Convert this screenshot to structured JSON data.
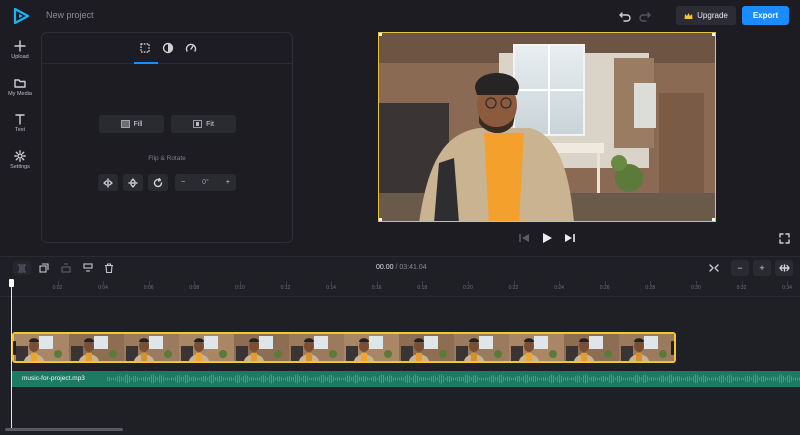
{
  "header": {
    "project_title": "New project",
    "upgrade_label": "Upgrade",
    "export_label": "Export",
    "brand_color": "#1a8cff"
  },
  "sidebar": {
    "items": [
      {
        "label": "Upload",
        "icon": "plus-icon"
      },
      {
        "label": "My Media",
        "icon": "folder-icon"
      },
      {
        "label": "Text",
        "icon": "text-icon"
      },
      {
        "label": "Settings",
        "icon": "gear-icon"
      }
    ]
  },
  "panel": {
    "tabs": [
      {
        "icon": "crop-icon",
        "active": true
      },
      {
        "icon": "contrast-icon",
        "active": false
      },
      {
        "icon": "speed-icon",
        "active": false
      }
    ],
    "fill_label": "Fill",
    "fit_label": "Fit",
    "flip_rotate_label": "Flip & Rotate",
    "angle_value": "0°"
  },
  "timeline": {
    "current_time": "00.00",
    "separator": "/",
    "total_time": "03:41.04",
    "ruler_ticks": [
      "0",
      "0:02",
      "0:04",
      "0:06",
      "0:08",
      "0:10",
      "0:12",
      "0:14",
      "0:16",
      "0:18",
      "0:20",
      "0:22",
      "0:24",
      "0:26",
      "0:28",
      "0:30",
      "0:32",
      "0:34"
    ],
    "audio_track_name": "music-for-project.mp3",
    "clip_border_color": "#f5c531",
    "audio_color": "#1e7b63"
  }
}
